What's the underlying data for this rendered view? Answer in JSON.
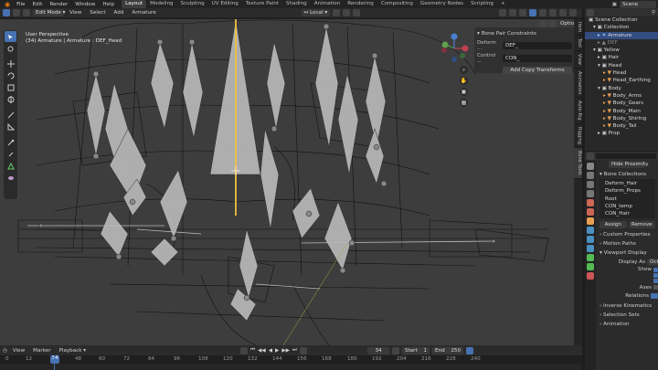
{
  "menu": [
    "File",
    "Edit",
    "Render",
    "Window",
    "Help"
  ],
  "workspaces": [
    "Layout",
    "Modeling",
    "Sculpting",
    "UV Editing",
    "Texture Paint",
    "Shading",
    "Animation",
    "Rendering",
    "Compositing",
    "Geometry Nodes",
    "Scripting"
  ],
  "active_workspace": "Layout",
  "scene_label": "Scene",
  "header": {
    "mode": "Edit Mode",
    "menus": [
      "View",
      "Select",
      "Add",
      "Armature"
    ],
    "orientation": "Local",
    "options": "Options"
  },
  "viewport": {
    "perspective": "User Perspective",
    "object_info": "(34) Armature | Armature : DEF_Head"
  },
  "npanel": {
    "title": "Bone Pair Constraints",
    "deform_label": "Deform ...",
    "deform_value": "DEF_",
    "control_label": "Control ...",
    "control_value": "CON_",
    "button": "Add Copy Transforms"
  },
  "side_tabs": [
    "Item",
    "Tool",
    "View",
    "Animation",
    "Auto-Rig",
    "Rigging",
    "Bone Tools"
  ],
  "outliner": {
    "items": [
      {
        "label": "Scene Collection",
        "indent": 0
      },
      {
        "label": "Collection",
        "indent": 1
      },
      {
        "label": "Armature",
        "indent": 2,
        "selected": true
      },
      {
        "label": "DEF",
        "indent": 2
      },
      {
        "label": "Yellow",
        "indent": 1
      },
      {
        "label": "Hair",
        "indent": 2
      },
      {
        "label": "Head",
        "indent": 2
      },
      {
        "label": "Head",
        "indent": 3
      },
      {
        "label": "Head_Earthing",
        "indent": 3
      },
      {
        "label": "Body",
        "indent": 2
      },
      {
        "label": "Body_Arms",
        "indent": 3
      },
      {
        "label": "Body_Gears",
        "indent": 3
      },
      {
        "label": "Body_Main",
        "indent": 3
      },
      {
        "label": "Body_Shirlng",
        "indent": 3
      },
      {
        "label": "Body_Tail",
        "indent": 3
      },
      {
        "label": "Prop",
        "indent": 2
      }
    ]
  },
  "properties": {
    "tab_label": "Hide Proximity",
    "bone_collections_title": "Bone Collections",
    "collections": [
      "Deform_Hair",
      "Deform_Props",
      "Root",
      "CON_temp",
      "CON_Hair"
    ],
    "assign": "Assign",
    "remove": "Remove",
    "sections": [
      "Custom Properties",
      "Motion Paths",
      "Viewport Display"
    ],
    "display_as_label": "Display As",
    "display_as_value": "Oct",
    "show_label": "Show",
    "axes_label": "Axes",
    "relations_label": "Relations",
    "bottom_sections": [
      "Inverse Kinematics",
      "Selection Sets",
      "Animation"
    ]
  },
  "timeline": {
    "menus": [
      "View",
      "Marker",
      "Playback"
    ],
    "current_frame": "34",
    "start_label": "Start",
    "start_value": "1",
    "end_label": "End",
    "end_value": "250",
    "ruler": [
      "0",
      "12",
      "34",
      "48",
      "60",
      "72",
      "84",
      "96",
      "108",
      "120",
      "132",
      "144",
      "156",
      "168",
      "180",
      "192",
      "204",
      "216",
      "228",
      "240"
    ]
  },
  "colors": {
    "accent": "#4772b3",
    "bone_selected": "#f0c040",
    "frame_indicator": "#4772b3"
  }
}
